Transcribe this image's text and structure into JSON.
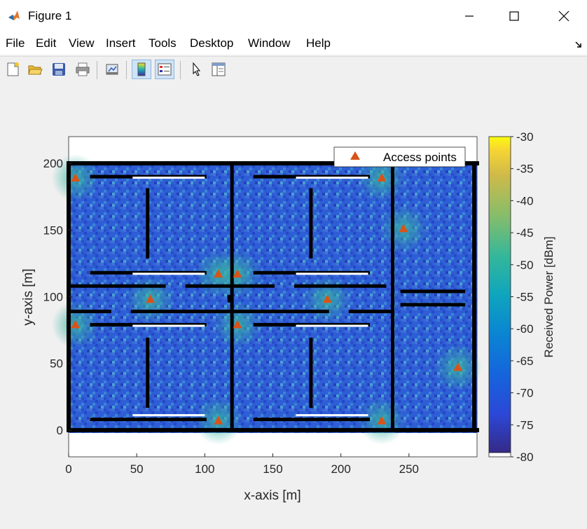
{
  "window": {
    "title": "Figure 1"
  },
  "menu": {
    "items": [
      "File",
      "Edit",
      "View",
      "Insert",
      "Tools",
      "Desktop",
      "Window",
      "Help"
    ]
  },
  "toolbar": {
    "buttons": [
      "new-figure-icon",
      "open-file-icon",
      "save-icon",
      "print-icon",
      "link-plot-icon",
      "insert-colorbar-icon",
      "insert-legend-icon",
      "pointer-icon",
      "property-editor-icon"
    ]
  },
  "colors": {
    "accent": "#d95319",
    "walls": "#000000",
    "map_background": "#2b5fd6"
  },
  "chart_data": {
    "type": "heatmap",
    "xlabel": "x-axis [m]",
    "ylabel": "y-axis [m]",
    "xlim": [
      0,
      300
    ],
    "ylim": [
      -20,
      220
    ],
    "xticks": [
      "0",
      "50",
      "100",
      "150",
      "200",
      "250"
    ],
    "yticks": [
      "0",
      "50",
      "100",
      "150",
      "200"
    ],
    "colorbar": {
      "label": "Received Power [dBm]",
      "range": [
        -80,
        -30
      ],
      "ticks": [
        "-30",
        "-35",
        "-40",
        "-45",
        "-50",
        "-55",
        "-60",
        "-65",
        "-70",
        "-75",
        "-80"
      ]
    },
    "legend": {
      "label": "Access points",
      "placement": "top-right"
    },
    "series": [
      {
        "name": "Access points",
        "points": [
          [
            5,
            189
          ],
          [
            110,
            117
          ],
          [
            124,
            117
          ],
          [
            230,
            189
          ],
          [
            246,
            151
          ],
          [
            60,
            98
          ],
          [
            190,
            98
          ],
          [
            5,
            79
          ],
          [
            124,
            79
          ],
          [
            110,
            7
          ],
          [
            230,
            7
          ],
          [
            286,
            47
          ]
        ]
      }
    ]
  }
}
